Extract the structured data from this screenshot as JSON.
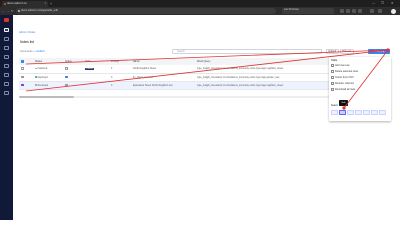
{
  "browser": {
    "tab_title": "demo.saltcorn.co",
    "new_tab": "+",
    "win_min": "—",
    "win_max": "❐",
    "win_close": "✕",
    "url": "demo.saltcorn.co/page/table_edit",
    "search_extension": "Last 30 Sortes",
    "nav_back": "←",
    "nav_forward": "→",
    "nav_reload": "↻"
  },
  "breadcrumb": {
    "root": "Admin",
    "sep": " / ",
    "current": "Notes"
  },
  "page": {
    "title": "Notes list",
    "subtitle_prefix": "Comments",
    "subtitle_link": "+ subfield"
  },
  "toolbar": {
    "search_placeholder": "Search",
    "btn_default": "Default",
    "btn_view": "Hide sel",
    "actions_label": "Actions ▾"
  },
  "table": {
    "columns": [
      "",
      "Status",
      "Active",
      "Value",
      "Priority",
      "Name",
      "Word Query"
    ],
    "rows": [
      {
        "status": "Inactived",
        "status_color": "#9ca3af",
        "active": false,
        "value": "Linked",
        "priority": "4",
        "name": "North Neighbor Street",
        "query": "type_insight_timestamp id correlations_summary entire type tags neighbor_street"
      },
      {
        "status": "Deployed",
        "status_color": "#10b981",
        "active": true,
        "value": "",
        "priority": "3",
        "name": "fix_object_recorder",
        "query": "type_insight_timestamp id correlations_summary entire type tags garden_tree"
      },
      {
        "status": "Reviewed",
        "status_color": "#9ca3af",
        "active": false,
        "value": "",
        "priority": "3",
        "name": "Equivalent Street North Neighbor Ave",
        "query": "type_insight_timestamp id correlations_summary entire type tags neighbor_street"
      }
    ]
  },
  "actions_menu": {
    "title": "Table",
    "items": [
      "Add new row",
      "Delete selected rows",
      "Import from CSV",
      "Reorder columns",
      "Download all rows"
    ],
    "section_label": "Select",
    "tooltip": "Edit"
  },
  "colors": {
    "accent": "#3b82f6",
    "sidebar_bg": "#101a38",
    "annotation_red": "#e03131"
  }
}
